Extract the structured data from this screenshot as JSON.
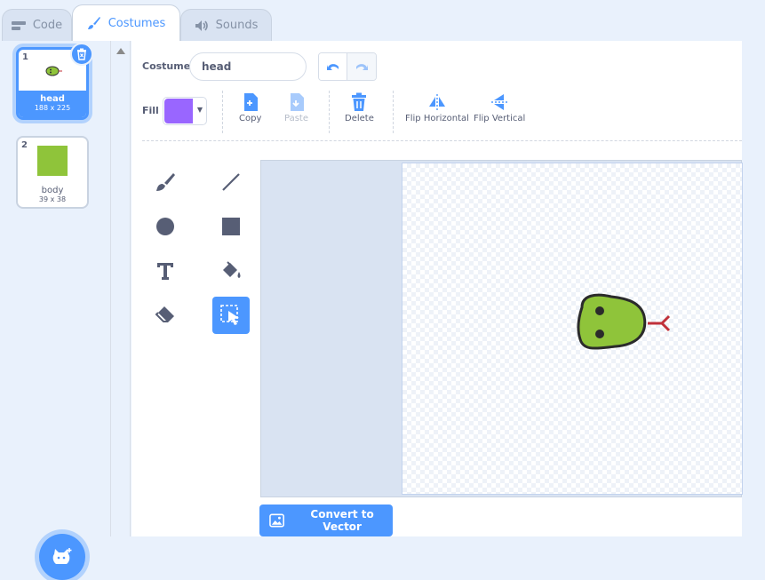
{
  "tabs": {
    "code": "Code",
    "costumes": "Costumes",
    "sounds": "Sounds"
  },
  "costumes": [
    {
      "number": "1",
      "name": "head",
      "size": "188 x 225"
    },
    {
      "number": "2",
      "name": "body",
      "size": "39 x 38"
    }
  ],
  "toolbar": {
    "costume_label": "Costume",
    "costume_name": "head",
    "fill_label": "Fill",
    "fill_color": "#9966ff",
    "actions": {
      "copy": "Copy",
      "paste": "Paste",
      "delete": "Delete",
      "flip_horizontal": "Flip Horizontal",
      "flip_vertical": "Flip Vertical"
    }
  },
  "convert_button": "Convert to Vector",
  "colors": {
    "accent": "#4c97ff",
    "snake_green": "#8fc43a",
    "tongue_red": "#c0303a"
  },
  "tools": [
    "brush-icon",
    "line-icon",
    "circle-icon",
    "rectangle-icon",
    "text-icon",
    "fill-icon",
    "eraser-icon",
    "select-icon"
  ],
  "active_tool": "select-icon"
}
